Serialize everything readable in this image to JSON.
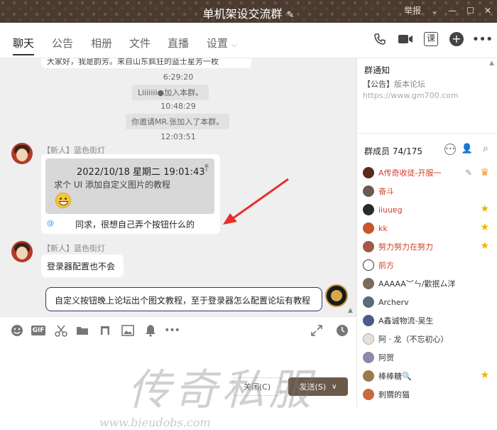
{
  "window": {
    "title": "单机架设交流群",
    "report_label": "举报"
  },
  "tabs": [
    {
      "label": "聊天"
    },
    {
      "label": "公告"
    },
    {
      "label": "相册"
    },
    {
      "label": "文件"
    },
    {
      "label": "直播"
    },
    {
      "label": "设置"
    }
  ],
  "tab_icons": {
    "course_label": "课"
  },
  "chat": {
    "top_partial": "大家好，我是韵芳。来自山东疯狂的蓝士星芳一枚",
    "t1": "6:29:20",
    "join1": "Liiiiiii●加入本群。",
    "t2": "10:48:29",
    "join2": "你邀请MR.张加入了本群。",
    "t3": "12:03:51",
    "msg1": {
      "sender": "【新人】蓝色街灯",
      "quote_time": "2022/10/18 星期二 19:01:43",
      "quote_text": "求个 UI 添加自定义图片的教程",
      "at": "@",
      "text": "同求，很想自己弄个按钮什么的"
    },
    "msg2": {
      "sender": "【新人】蓝色街灯",
      "text": "登录器配置也不会"
    },
    "msg3": {
      "text": "自定义按钮晚上论坛出个图文教程，至于登录器怎么配置论坛有教程"
    }
  },
  "input": {
    "close_label": "关闭(C)",
    "send_label": "发送(S)"
  },
  "right_panel": {
    "notice_title": "群通知",
    "notice_tag": "【公告】",
    "notice_text": "版本论坛",
    "notice_url": "https://www.gm700.com",
    "members_title": "群成员 74/175",
    "members": [
      {
        "name": "A传奇收徒-开服一",
        "color": "#d0402a"
      },
      {
        "name": "奋斗",
        "color": "#d0402a"
      },
      {
        "name": "iiuuɐg",
        "color": "#d0402a"
      },
      {
        "name": "kk",
        "color": "#d0402a"
      },
      {
        "name": "努力努力在努力",
        "color": "#d0402a"
      },
      {
        "name": "前方",
        "color": "#d0402a"
      },
      {
        "name": "AAAAA︶ㄣ/歡抿ㄙ洋",
        "color": "#333333"
      },
      {
        "name": "Archerv",
        "color": "#333333"
      },
      {
        "name": "A鑫诚物流-吴生",
        "color": "#333333"
      },
      {
        "name": "阿 · 龙（不忘初心）",
        "color": "#333333"
      },
      {
        "name": "阿贺",
        "color": "#333333"
      },
      {
        "name": "棒棒糖🔍",
        "color": "#333333"
      },
      {
        "name": "刺猬的猫",
        "color": "#333333"
      }
    ]
  },
  "watermark": {
    "text": "传奇私服",
    "url": "www.bieudobs.com"
  }
}
